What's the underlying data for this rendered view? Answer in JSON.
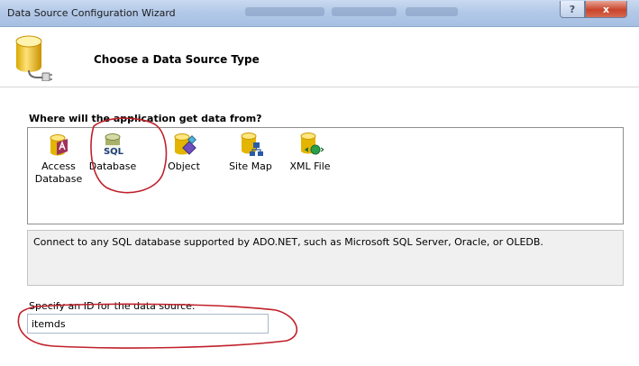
{
  "window": {
    "title": "Data Source Configuration Wizard",
    "help_label": "?",
    "close_label": "x"
  },
  "header": {
    "title": "Choose a Data Source Type"
  },
  "question": "Where will the application get data from?",
  "sources": [
    {
      "label": "Access Database",
      "icon": "access-database-icon"
    },
    {
      "label": "Database",
      "badge": "SQL",
      "icon": "sql-database-icon",
      "selected": true
    },
    {
      "label": "Object",
      "icon": "object-icon"
    },
    {
      "label": "Site Map",
      "icon": "site-map-icon"
    },
    {
      "label": "XML File",
      "icon": "xml-file-icon"
    }
  ],
  "description": "Connect to any SQL database supported by ADO.NET, such as Microsoft SQL Server, Oracle, or OLEDB.",
  "id_field": {
    "label": "Specify an ID for the data source:",
    "value": "itemds"
  },
  "colors": {
    "highlight_circle": "#c0202a",
    "titlebar": "#b3c9e8",
    "close_button": "#c8442a"
  }
}
